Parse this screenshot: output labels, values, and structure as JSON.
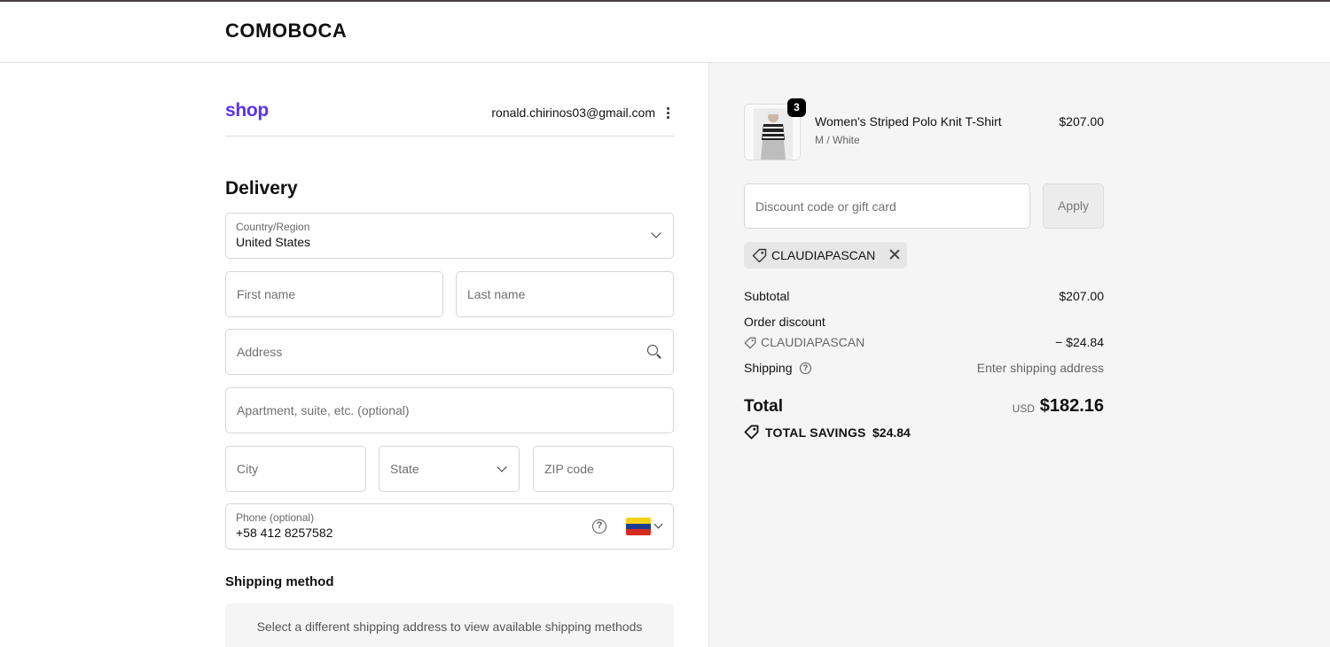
{
  "header": {
    "brand": "COMOBOCA"
  },
  "account": {
    "logo": "shop",
    "email": "ronald.chirinos03@gmail.com",
    "menu_icon": "kebab-menu-icon"
  },
  "delivery": {
    "heading": "Delivery",
    "country": {
      "label": "Country/Region",
      "value": "United States"
    },
    "first_name": {
      "placeholder": "First name"
    },
    "last_name": {
      "placeholder": "Last name"
    },
    "address": {
      "placeholder": "Address"
    },
    "apartment": {
      "placeholder": "Apartment, suite, etc. (optional)"
    },
    "city": {
      "placeholder": "City"
    },
    "state": {
      "placeholder": "State"
    },
    "zip": {
      "placeholder": "ZIP code"
    },
    "phone": {
      "label": "Phone (optional)",
      "value": "+58 412 8257582",
      "help": "?",
      "flag": "venezuela-flag"
    }
  },
  "shipping": {
    "heading": "Shipping method",
    "note": "Select a different shipping address to view available shipping methods"
  },
  "cart": {
    "item": {
      "quantity": "3",
      "title": "Women's Striped Polo Knit T-Shirt",
      "variant": "M / White",
      "price": "$207.00"
    },
    "discount": {
      "placeholder": "Discount code or gift card",
      "apply_label": "Apply"
    },
    "applied_code": "CLAUDIAPASCAN",
    "summary": {
      "subtotal_label": "Subtotal",
      "subtotal_value": "$207.00",
      "order_discount_label": "Order discount",
      "discount_code": "CLAUDIAPASCAN",
      "discount_value": "− $24.84",
      "shipping_label": "Shipping",
      "shipping_help": "?",
      "shipping_value": "Enter shipping address",
      "total_label": "Total",
      "currency": "USD",
      "total_value": "$182.16",
      "savings_label": "TOTAL SAVINGS",
      "savings_value": "$24.84"
    }
  },
  "colors": {
    "shop_brand": "#5a31f4",
    "right_panel_bg": "#f5f5f5",
    "badge_bg": "#000000"
  }
}
